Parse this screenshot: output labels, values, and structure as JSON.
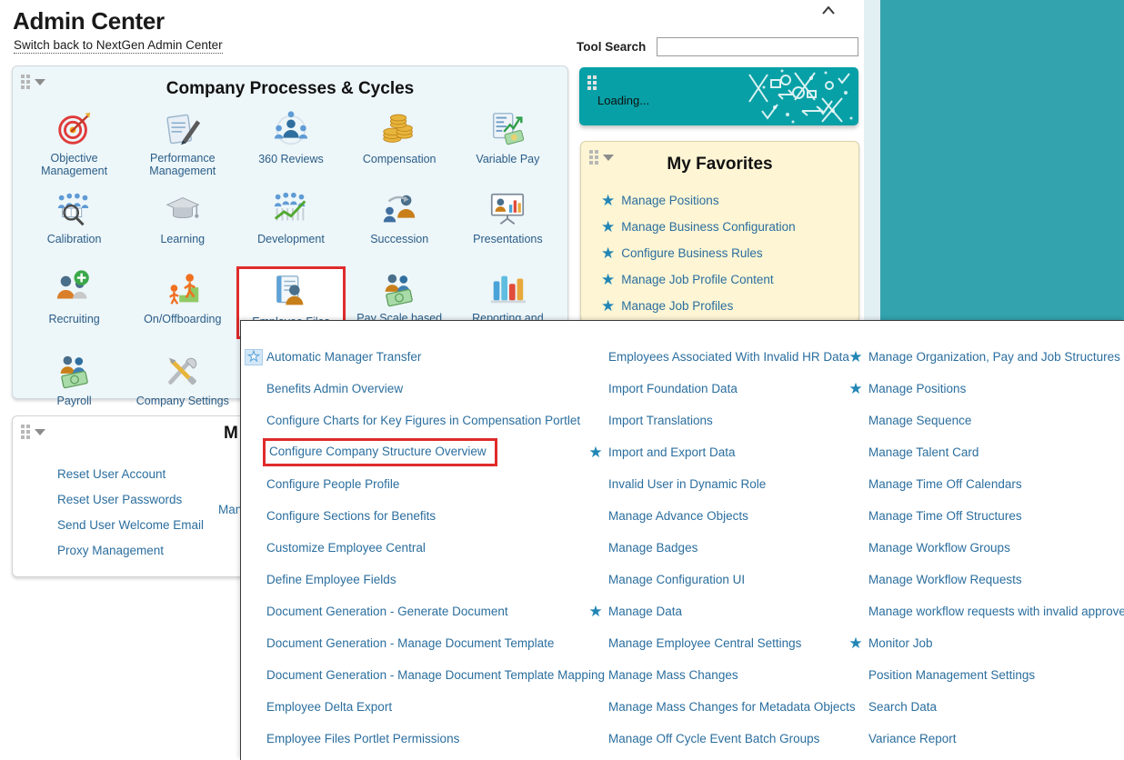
{
  "header": {
    "title": "Admin Center",
    "switch_link": "Switch back to NextGen Admin Center",
    "tool_search_label": "Tool Search",
    "tool_search_value": "",
    "tool_search_placeholder": "",
    "collapse_icon": "chevron-up-icon"
  },
  "colors": {
    "teal_background": "#33a3ae",
    "loading_tile": "#06a0a6",
    "link_blue": "#2b6e9e",
    "star_blue": "#2286b5",
    "highlight_red": "#e02b2b",
    "portlet_blue_bg": "#edf6f9",
    "portlet_yellow_bg": "#fdf5d4"
  },
  "portlets": {
    "company_processes": {
      "title": "Company Processes & Cycles",
      "tiles": [
        {
          "label": "Objective Management",
          "icon": "target-icon",
          "selected": false
        },
        {
          "label": "Performance Management",
          "icon": "document-pen-icon",
          "selected": false
        },
        {
          "label": "360 Reviews",
          "icon": "people-circle-icon",
          "selected": false
        },
        {
          "label": "Compensation",
          "icon": "coins-icon",
          "selected": false
        },
        {
          "label": "Variable Pay",
          "icon": "chart-money-icon",
          "selected": false
        },
        {
          "label": "Calibration",
          "icon": "people-magnifier-icon",
          "selected": false
        },
        {
          "label": "Learning",
          "icon": "graduation-cap-icon",
          "selected": false
        },
        {
          "label": "Development",
          "icon": "people-growth-chart-icon",
          "selected": false
        },
        {
          "label": "Succession",
          "icon": "person-arrow-icon",
          "selected": false
        },
        {
          "label": "Presentations",
          "icon": "presentation-board-icon",
          "selected": false
        },
        {
          "label": "Recruiting",
          "icon": "person-plus-icon",
          "selected": false
        },
        {
          "label": "On/Offboarding",
          "icon": "people-steps-icon",
          "selected": false
        },
        {
          "label": "Employee Files",
          "icon": "file-person-icon",
          "selected": true
        },
        {
          "label": "Pay Scale based pay",
          "icon": "people-money-icon",
          "selected": false
        },
        {
          "label": "Reporting and Analytics",
          "icon": "bar-chart-icon",
          "selected": false
        },
        {
          "label": "Payroll",
          "icon": "people-money-icon",
          "selected": false
        },
        {
          "label": "Company Settings",
          "icon": "tools-icon",
          "selected": false
        }
      ]
    },
    "loading_tile": {
      "label": "Loading..."
    },
    "my_favorites": {
      "title": "My Favorites",
      "items": [
        "Manage Positions",
        "Manage Business Configuration",
        "Configure Business Rules",
        "Manage Job Profile Content",
        "Manage Job Profiles"
      ]
    },
    "manager_portlet": {
      "title_partial": "M",
      "hidden_word": "Man",
      "items": [
        "Reset User Account",
        "Reset User Passwords",
        "Send User Welcome Email",
        "Proxy Management"
      ]
    }
  },
  "mega_menu": {
    "column1": [
      {
        "label": "Automatic Manager Transfer",
        "star": "hollow",
        "highlight": false
      },
      {
        "label": "Benefits Admin Overview",
        "star": "none",
        "highlight": false
      },
      {
        "label": "Configure Charts for Key Figures in Compensation Portlet",
        "star": "none",
        "highlight": false
      },
      {
        "label": "Configure Company Structure Overview",
        "star": "none",
        "highlight": true
      },
      {
        "label": "Configure People Profile",
        "star": "none",
        "highlight": false
      },
      {
        "label": "Configure Sections for Benefits",
        "star": "none",
        "highlight": false
      },
      {
        "label": "Customize Employee Central",
        "star": "none",
        "highlight": false
      },
      {
        "label": "Define Employee Fields",
        "star": "none",
        "highlight": false
      },
      {
        "label": "Document Generation - Generate Document",
        "star": "none",
        "highlight": false
      },
      {
        "label": "Document Generation - Manage Document Template",
        "star": "none",
        "highlight": false
      },
      {
        "label": "Document Generation - Manage Document Template Mapping",
        "star": "none",
        "highlight": false
      },
      {
        "label": "Employee Delta Export",
        "star": "none",
        "highlight": false
      },
      {
        "label": "Employee Files Portlet Permissions",
        "star": "none",
        "highlight": false
      }
    ],
    "column2": [
      {
        "label": "Employees Associated With Invalid HR Data",
        "star": "none",
        "highlight": false
      },
      {
        "label": "Import Foundation Data",
        "star": "none",
        "highlight": false
      },
      {
        "label": "Import Translations",
        "star": "none",
        "highlight": false
      },
      {
        "label": "Import and Export Data",
        "star": "solid",
        "highlight": false
      },
      {
        "label": "Invalid User in Dynamic Role",
        "star": "none",
        "highlight": false
      },
      {
        "label": "Manage Advance Objects",
        "star": "none",
        "highlight": false
      },
      {
        "label": "Manage Badges",
        "star": "none",
        "highlight": false
      },
      {
        "label": "Manage Configuration UI",
        "star": "none",
        "highlight": false
      },
      {
        "label": "Manage Data",
        "star": "solid",
        "highlight": false
      },
      {
        "label": "Manage Employee Central Settings",
        "star": "none",
        "highlight": false
      },
      {
        "label": "Manage Mass Changes",
        "star": "none",
        "highlight": false
      },
      {
        "label": "Manage Mass Changes for Metadata Objects",
        "star": "none",
        "highlight": false
      },
      {
        "label": "Manage Off Cycle Event Batch Groups",
        "star": "none",
        "highlight": false
      }
    ],
    "column3": [
      {
        "label": "Manage Organization, Pay and Job Structures",
        "star": "solid",
        "highlight": false
      },
      {
        "label": "Manage Positions",
        "star": "solid",
        "highlight": false
      },
      {
        "label": "Manage Sequence",
        "star": "none",
        "highlight": false
      },
      {
        "label": "Manage Talent Card",
        "star": "none",
        "highlight": false
      },
      {
        "label": "Manage Time Off Calendars",
        "star": "none",
        "highlight": false
      },
      {
        "label": "Manage Time Off Structures",
        "star": "none",
        "highlight": false
      },
      {
        "label": "Manage Workflow Groups",
        "star": "none",
        "highlight": false
      },
      {
        "label": "Manage Workflow Requests",
        "star": "none",
        "highlight": false
      },
      {
        "label": "Manage workflow requests with invalid approvers",
        "star": "none",
        "highlight": false
      },
      {
        "label": "Monitor Job",
        "star": "solid",
        "highlight": false
      },
      {
        "label": "Position Management Settings",
        "star": "none",
        "highlight": false
      },
      {
        "label": "Search Data",
        "star": "none",
        "highlight": false
      },
      {
        "label": "Variance Report",
        "star": "none",
        "highlight": false
      }
    ]
  }
}
